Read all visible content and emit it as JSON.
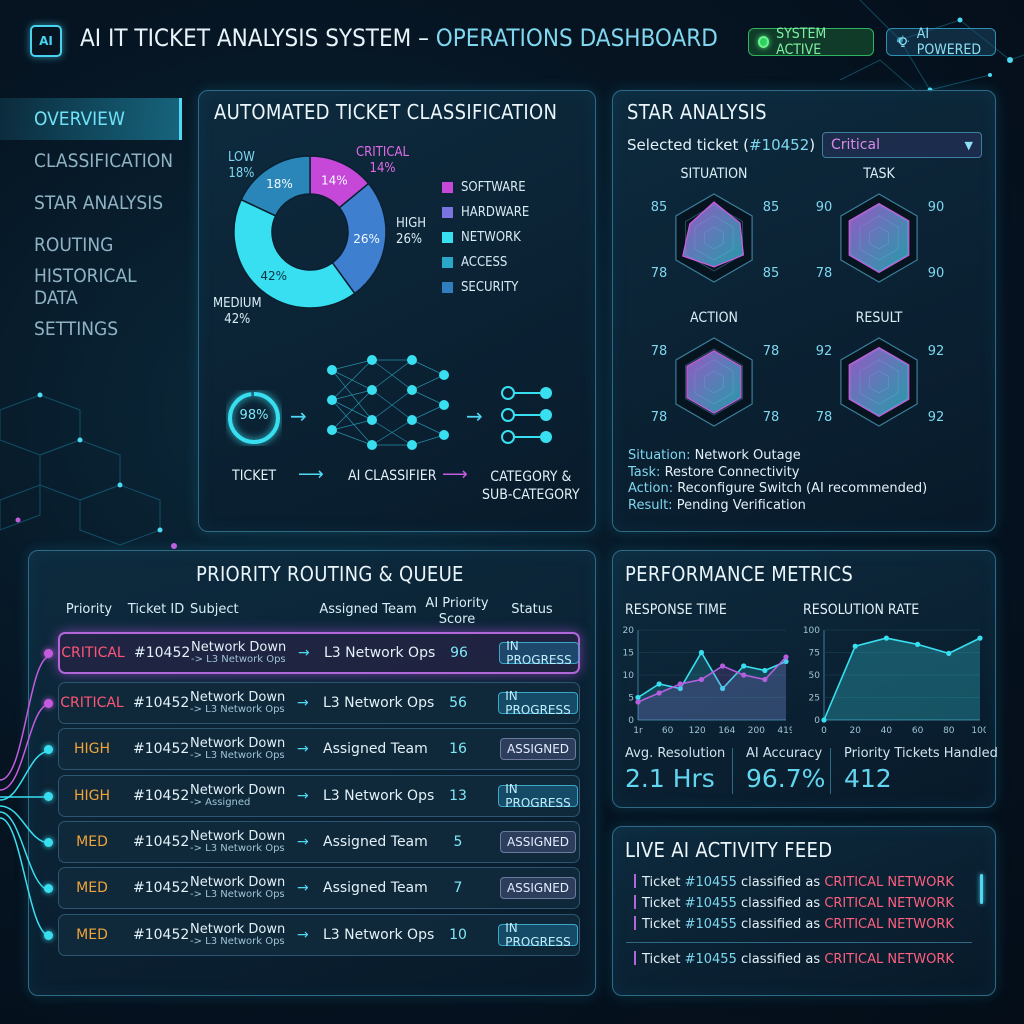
{
  "header": {
    "ai_chip": "AI",
    "title_main": "AI IT TICKET ANALYSIS SYSTEM – ",
    "title_accent": "OPERATIONS DASHBOARD",
    "status_active": "SYSTEM ACTIVE",
    "status_ai": "AI POWERED",
    "colors": {
      "accent": "#47d3ef",
      "active": "#2fd060"
    }
  },
  "sidebar": {
    "items": [
      {
        "label": "OVERVIEW",
        "active": true
      },
      {
        "label": "CLASSIFICATION"
      },
      {
        "label": "STAR ANALYSIS"
      },
      {
        "label": "ROUTING"
      },
      {
        "label": "HISTORICAL DATA"
      },
      {
        "label": "SETTINGS"
      }
    ]
  },
  "classification": {
    "title": "AUTOMATED TICKET CLASSIFICATION",
    "chart_data": {
      "type": "pie",
      "donut": true,
      "slices": [
        {
          "name": "CRITICAL",
          "value": 14,
          "label": "14%",
          "color": "#c548d8"
        },
        {
          "name": "HIGH",
          "value": 26,
          "label": "26%",
          "color": "#3e7fd0"
        },
        {
          "name": "MEDIUM",
          "value": 42,
          "label": "42%",
          "color": "#38dff0"
        },
        {
          "name": "LOW",
          "value": 18,
          "label": "18%",
          "color": "#2a86b8"
        }
      ]
    },
    "outer_labels": {
      "low_name": "LOW",
      "low_pct": "18%",
      "critical_name": "CRITICAL",
      "critical_pct": "14%",
      "high_name": "HIGH",
      "high_pct": "26%",
      "medium_name": "MEDIUM",
      "medium_pct": "42%"
    },
    "legend": [
      {
        "label": "SOFTWARE",
        "color": "#c548d8"
      },
      {
        "label": "HARDWARE",
        "color": "#7a74e0"
      },
      {
        "label": "NETWORK",
        "color": "#38dff0"
      },
      {
        "label": "ACCESS",
        "color": "#2aa6c8"
      },
      {
        "label": "SECURITY",
        "color": "#2f7fc0"
      }
    ],
    "pipeline": {
      "confidence": "98%",
      "ticket": "TICKET",
      "classifier": "AI CLASSIFIER",
      "category_line1": "CATEGORY &",
      "category_line2": "SUB-CATEGORY",
      "confidence_fraction": 0.98
    }
  },
  "star": {
    "title": "STAR ANALYSIS",
    "selected_prefix": "Selected ticket (",
    "selected_id": "#10452",
    "selected_suffix": ")",
    "dropdown_value": "Critical",
    "quadrants": [
      {
        "label": "SITUATION",
        "tl": "85",
        "tr": "85",
        "bl": "78",
        "br": "85",
        "color": "#d35be0"
      },
      {
        "label": "TASK",
        "tl": "90",
        "tr": "90",
        "bl": "78",
        "br": "90",
        "color": "#c65cd8"
      },
      {
        "label": "ACTION",
        "tl": "78",
        "tr": "78",
        "bl": "78",
        "br": "78",
        "color": "#c65cd8"
      },
      {
        "label": "RESULT",
        "tl": "92",
        "tr": "92",
        "bl": "78",
        "br": "92",
        "color": "#c65cd8"
      }
    ],
    "summary": [
      {
        "key": "Situation:",
        "value": " Network Outage"
      },
      {
        "key": "Task:",
        "value": " Restore Connectivity"
      },
      {
        "key": "Action:",
        "value": " Reconfigure Switch (AI recommended)"
      },
      {
        "key": "Result:",
        "value": " Pending Verification"
      }
    ]
  },
  "routing": {
    "title": "PRIORITY ROUTING & QUEUE",
    "columns": [
      "Priority",
      "Ticket ID",
      "Subject",
      "Assigned Team",
      "AI Priority",
      "Score",
      "Status"
    ],
    "rows": [
      {
        "priority": "CRITICAL",
        "id": "#10452",
        "subject": "Network Down",
        "sub": "-> L3 Network Ops",
        "team": "L3 Network Ops",
        "score": "96",
        "status": "IN PROGRESS"
      },
      {
        "priority": "CRITICAL",
        "id": "#10452",
        "subject": "Network Down",
        "sub": "-> L3 Network Ops",
        "team": "L3 Network Ops",
        "score": "56",
        "status": "IN PROGRESS"
      },
      {
        "priority": "HIGH",
        "id": "#10452",
        "subject": "Network Down",
        "sub": "-> L3 Network Ops",
        "team": "Assigned Team",
        "score": "16",
        "status": "ASSIGNED"
      },
      {
        "priority": "HIGH",
        "id": "#10452",
        "subject": "Network Down",
        "sub": "-> Assigned",
        "team": "L3 Network Ops",
        "score": "13",
        "status": "IN PROGRESS"
      },
      {
        "priority": "MED",
        "id": "#10452",
        "subject": "Network Down",
        "sub": "-> L3 Network Ops",
        "team": "Assigned Team",
        "score": "5",
        "status": "ASSIGNED"
      },
      {
        "priority": "MED",
        "id": "#10452",
        "subject": "Network Down",
        "sub": "-> L3 Network Ops",
        "team": "Assigned Team",
        "score": "7",
        "status": "ASSIGNED"
      },
      {
        "priority": "MED",
        "id": "#10452",
        "subject": "Network Down",
        "sub": "-> L3 Network Ops",
        "team": "L3 Network Ops",
        "score": "10",
        "status": "IN PROGRESS"
      }
    ],
    "arrow": "→",
    "priority_colors": {
      "CRITICAL": "#ff5577",
      "HIGH": "#f0a43a",
      "MED": "#f0a43a"
    }
  },
  "metrics": {
    "title": "PERFORMANCE METRICS",
    "chart_data": [
      {
        "type": "line",
        "title": "RESPONSE TIME",
        "x": [
          "1r",
          "60",
          "120",
          "164",
          "200",
          "419"
        ],
        "ylim": [
          0,
          20
        ],
        "yticks": [
          "0",
          "5",
          "10",
          "15",
          "20"
        ],
        "series": [
          {
            "values": [
              5,
              8,
              7,
              15,
              7,
              12,
              11,
              13
            ],
            "color": "#38dff0"
          },
          {
            "values": [
              4,
              6,
              8,
              9,
              12,
              10,
              9,
              14
            ],
            "color": "#b55fe0"
          }
        ]
      },
      {
        "type": "area",
        "title": "RESOLUTION RATE",
        "x": [
          "0",
          "20",
          "40",
          "60",
          "80",
          "100"
        ],
        "ylim": [
          0,
          100
        ],
        "yticks": [
          "0",
          "25",
          "50",
          "75",
          "100"
        ],
        "series": [
          {
            "values": [
              0,
              82,
              91,
              84,
              74,
              91
            ],
            "color": "#38dff0"
          }
        ]
      }
    ],
    "kpis": [
      {
        "label": "Avg. Resolution",
        "value": "2.1 Hrs"
      },
      {
        "label": "AI Accuracy",
        "value": "96.7%"
      },
      {
        "label": "Priority Tickets Handled",
        "value": "412"
      }
    ]
  },
  "feed": {
    "title": "LIVE AI ACTIVITY FEED",
    "items": [
      {
        "prefix": "Ticket ",
        "id": "#10455",
        "mid": " classified as ",
        "tag": "CRITICAL NETWORK"
      },
      {
        "prefix": "Ticket ",
        "id": "#10455",
        "mid": " classified as ",
        "tag": "CRITICAL NETWORK"
      },
      {
        "prefix": "Ticket ",
        "id": "#10455",
        "mid": " classified as ",
        "tag": "CRITICAL NETWORK"
      },
      {
        "prefix": "Ticket ",
        "id": "#10455",
        "mid": " classified as ",
        "tag": "CRITICAL NETWORK"
      }
    ]
  }
}
